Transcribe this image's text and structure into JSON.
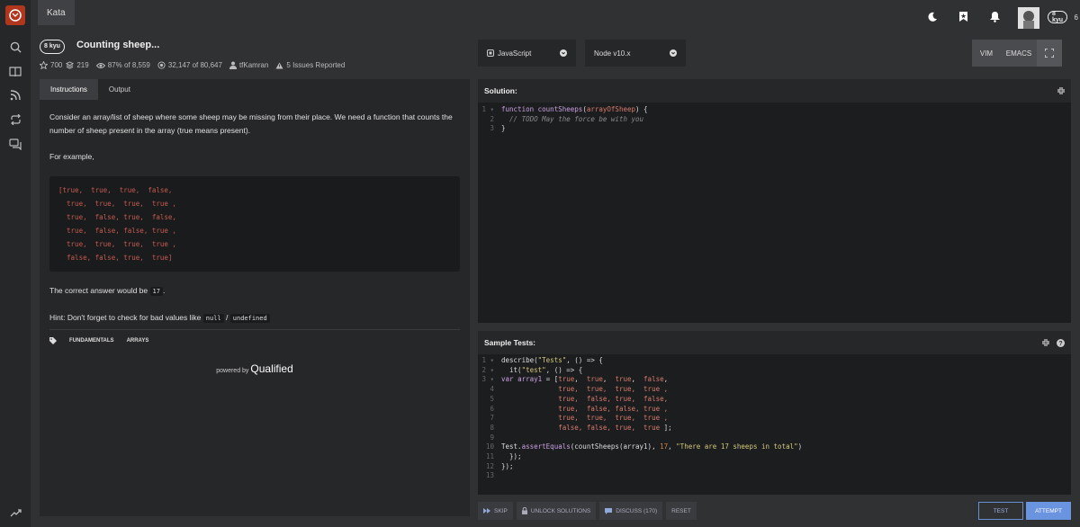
{
  "topbar": {
    "tab": "Kata",
    "user_rank": "8 kyu",
    "honor": "6"
  },
  "kata": {
    "rank": "8 kyu",
    "title": "Counting sheep...",
    "stars": "700",
    "stack": "219",
    "satisfaction": "87% of 8,559",
    "completed": "32,147 of 80,647",
    "author": "tfKamran",
    "issues": "5 Issues Reported"
  },
  "tabs": {
    "instructions": "Instructions",
    "output": "Output"
  },
  "description": {
    "p1": "Consider an array/list of sheep where some sheep may be missing from their place. We need a function that counts the number of sheep present in the array (true means present).",
    "p2": "For example,",
    "code_lines": [
      "[true,  true,  true,  false,",
      "  true,  true,  true,  true ,",
      "  true,  false, true,  false,",
      "  true,  false, false, true ,",
      "  true,  true,  true,  true ,",
      "  false, false, true,  true]"
    ],
    "answer_prefix": "The correct answer would be",
    "answer": "17",
    "answer_suffix": ".",
    "hint_prefix": "Hint: Don't forget to check for bad values like",
    "hint_code1": "null",
    "hint_sep": "/",
    "hint_code2": "undefined"
  },
  "tags": [
    "FUNDAMENTALS",
    "ARRAYS"
  ],
  "powered": {
    "by": "powered by",
    "brand": "Qualified"
  },
  "language": "JavaScript",
  "runtime": "Node v10.x",
  "modes": {
    "vim": "VIM",
    "emacs": "EMACS"
  },
  "solution": {
    "label": "Solution:",
    "lines": [
      "function countSheeps(arrayOfSheep) {",
      "  // TODO May the force be with you",
      "}"
    ]
  },
  "tests": {
    "label": "Sample Tests:",
    "lines": [
      "describe(\"Tests\", () => {",
      "  it(\"test\", () => {",
      "var array1 = [true,  true,  true,  false,",
      "              true,  true,  true,  true ,",
      "              true,  false, true,  false,",
      "              true,  false, false, true ,",
      "              true,  true,  true,  true ,",
      "              false, false, true,  true ];",
      "",
      "Test.assertEquals(countSheeps(array1), 17, \"There are 17 sheeps in total\")",
      "  });",
      "});",
      ""
    ]
  },
  "actions": {
    "skip": "SKIP",
    "unlock": "UNLOCK SOLUTIONS",
    "discuss": "DISCUSS (170)",
    "reset": "RESET",
    "test": "TEST",
    "attempt": "ATTEMPT"
  }
}
